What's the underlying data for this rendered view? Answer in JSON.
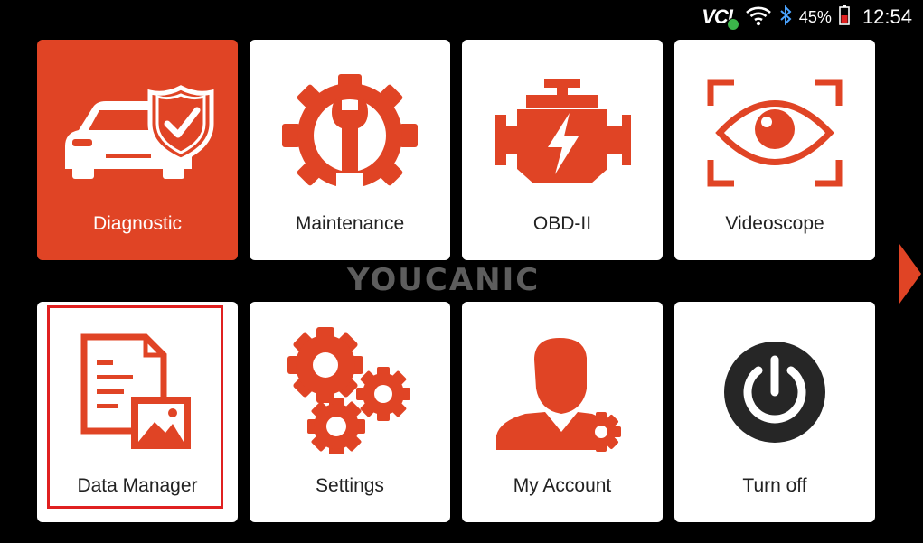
{
  "status": {
    "vci_label": "VCI",
    "battery": "45%",
    "time": "12:54",
    "icons": [
      "vci-connected-icon",
      "wifi-icon",
      "bluetooth-icon",
      "battery-icon"
    ]
  },
  "tiles": [
    {
      "label": "Diagnostic",
      "icon": "car-shield-icon",
      "active": true
    },
    {
      "label": "Maintenance",
      "icon": "gear-wrench-icon"
    },
    {
      "label": "OBD-II",
      "icon": "engine-icon"
    },
    {
      "label": "Videoscope",
      "icon": "eye-scope-icon"
    },
    {
      "label": "Data Manager",
      "icon": "documents-image-icon",
      "highlighted": true
    },
    {
      "label": "Settings",
      "icon": "gears-icon"
    },
    {
      "label": "My Account",
      "icon": "user-gear-icon"
    },
    {
      "label": "Turn off",
      "icon": "power-icon"
    }
  ],
  "watermark": "YOUCANIC",
  "colors": {
    "accent": "#e04425",
    "background": "#000000",
    "tile": "#ffffff",
    "highlight": "#e02020"
  }
}
